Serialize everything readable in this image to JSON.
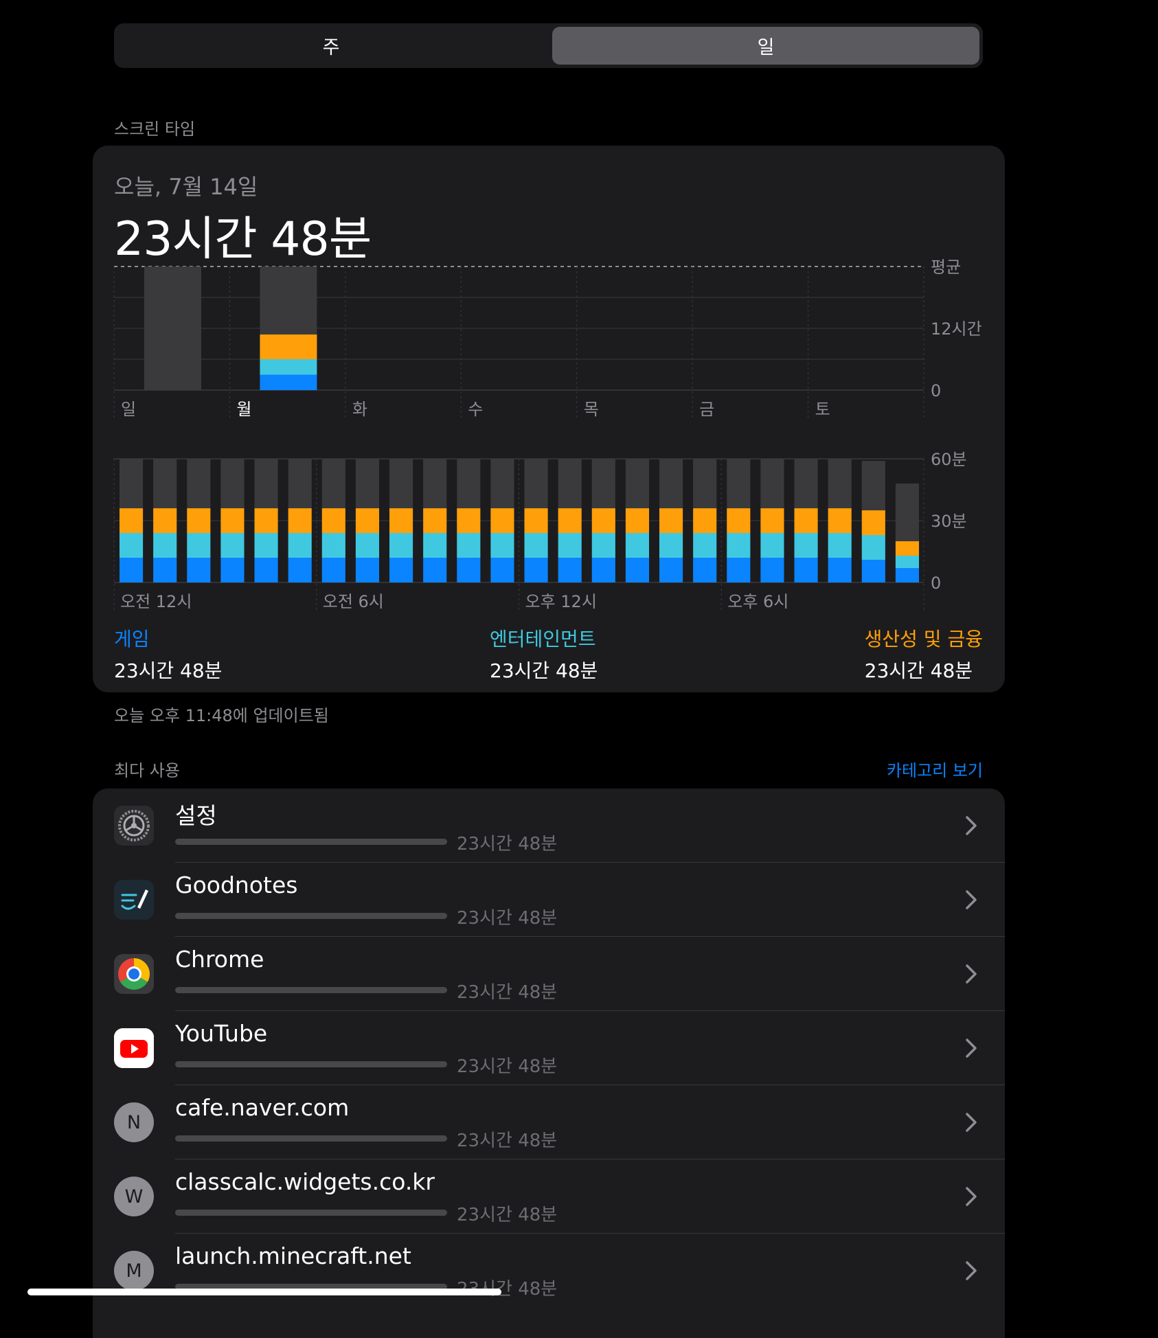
{
  "segmented": {
    "week_label": "주",
    "day_label": "일",
    "selected": "day"
  },
  "screen_time": {
    "section_title": "스크린 타임",
    "date": "오늘, 7월 14일",
    "total": "23시간 48분",
    "updated": "오늘 오후 11:48에 업데이트됨"
  },
  "colors": {
    "background": "#000000",
    "card": "#1c1c1e",
    "game": "#0a84ff",
    "entertainment": "#40c8e0",
    "productivity": "#ff9f0a",
    "other": "#3a3a3c",
    "link": "#0a84ff"
  },
  "chart_data": [
    {
      "type": "bar",
      "stacked": true,
      "title": "",
      "categories": [
        "일",
        "월",
        "화",
        "수",
        "목",
        "금",
        "토"
      ],
      "y_tick_labels": [
        "평균",
        "12시간",
        "0"
      ],
      "ylim": [
        0,
        24
      ],
      "average": 24,
      "grid": true,
      "series": [
        {
          "key": "game",
          "values": [
            0,
            3.0,
            0,
            0,
            0,
            0,
            0
          ]
        },
        {
          "key": "entertainment",
          "values": [
            0,
            3.0,
            0,
            0,
            0,
            0,
            0
          ]
        },
        {
          "key": "productivity",
          "values": [
            0,
            4.8,
            0,
            0,
            0,
            0,
            0
          ]
        },
        {
          "key": "other",
          "values": [
            24,
            13.2,
            0,
            0,
            0,
            0,
            0
          ]
        }
      ]
    },
    {
      "type": "bar",
      "stacked": true,
      "title": "",
      "x_tick_labels": [
        "오전 12시",
        "오전 6시",
        "오후 12시",
        "오후 6시"
      ],
      "y_tick_labels": [
        "60분",
        "30분",
        "0"
      ],
      "ylim": [
        0,
        60
      ],
      "hours": 24,
      "grid": true,
      "series": [
        {
          "key": "game",
          "values": [
            12,
            12,
            12,
            12,
            12,
            12,
            12,
            12,
            12,
            12,
            12,
            12,
            12,
            12,
            12,
            12,
            12,
            12,
            12,
            12,
            12,
            12,
            11,
            7
          ]
        },
        {
          "key": "entertainment",
          "values": [
            12,
            12,
            12,
            12,
            12,
            12,
            12,
            12,
            12,
            12,
            12,
            12,
            12,
            12,
            12,
            12,
            12,
            12,
            12,
            12,
            12,
            12,
            12,
            6
          ]
        },
        {
          "key": "productivity",
          "values": [
            12,
            12,
            12,
            12,
            12,
            12,
            12,
            12,
            12,
            12,
            12,
            12,
            12,
            12,
            12,
            12,
            12,
            12,
            12,
            12,
            12,
            12,
            12,
            7
          ]
        },
        {
          "key": "other",
          "values": [
            24,
            24,
            24,
            24,
            24,
            24,
            24,
            24,
            24,
            24,
            24,
            24,
            24,
            24,
            24,
            24,
            24,
            24,
            24,
            24,
            24,
            24,
            24,
            28
          ]
        }
      ]
    }
  ],
  "categories": [
    {
      "name": "게임",
      "value": "23시간 48분",
      "color": "#0a84ff"
    },
    {
      "name": "엔터테인먼트",
      "value": "23시간 48분",
      "color": "#40c8e0"
    },
    {
      "name": "생산성 및 금융",
      "value": "23시간 48분",
      "color": "#ff9f0a"
    }
  ],
  "most_used": {
    "title": "최다 사용",
    "link": "카테고리 보기",
    "items": [
      {
        "name": "설정",
        "time": "23시간 48분",
        "icon": "settings-gear-icon",
        "fill": 1.0
      },
      {
        "name": "Goodnotes",
        "time": "23시간 48분",
        "icon": "goodnotes-icon",
        "fill": 1.0
      },
      {
        "name": "Chrome",
        "time": "23시간 48분",
        "icon": "chrome-icon",
        "fill": 1.0
      },
      {
        "name": "YouTube",
        "time": "23시간 48분",
        "icon": "youtube-icon",
        "fill": 1.0
      },
      {
        "name": "cafe.naver.com",
        "time": "23시간 48분",
        "icon": "letter-icon",
        "letter": "N",
        "fill": 1.0
      },
      {
        "name": "classcalc.widgets.co.kr",
        "time": "23시간 48분",
        "icon": "letter-icon",
        "letter": "W",
        "fill": 1.0
      },
      {
        "name": "launch.minecraft.net",
        "time": "23시간 48분",
        "icon": "letter-icon",
        "letter": "M",
        "fill": 1.0
      }
    ]
  }
}
